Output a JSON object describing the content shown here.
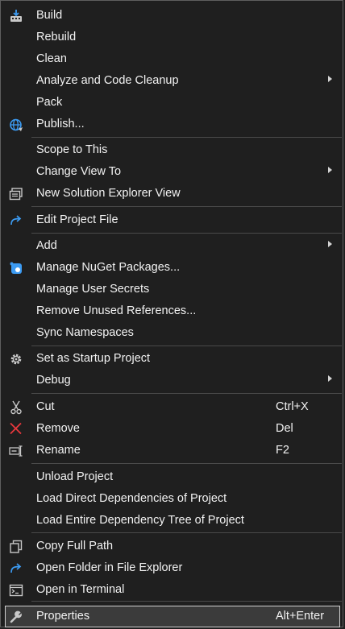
{
  "menu": {
    "build": {
      "label": "Build",
      "icon": "build-icon"
    },
    "rebuild": {
      "label": "Rebuild"
    },
    "clean": {
      "label": "Clean"
    },
    "analyze": {
      "label": "Analyze and Code Cleanup"
    },
    "pack": {
      "label": "Pack"
    },
    "publish": {
      "label": "Publish...",
      "icon": "globe-icon"
    },
    "scope_to_this": {
      "label": "Scope to This"
    },
    "change_view_to": {
      "label": "Change View To"
    },
    "new_solution_explorer_view": {
      "label": "New Solution Explorer View",
      "icon": "new-window-icon"
    },
    "edit_project_file": {
      "label": "Edit Project File",
      "icon": "redo-arrow-icon"
    },
    "add": {
      "label": "Add"
    },
    "manage_nuget": {
      "label": "Manage NuGet Packages...",
      "icon": "nuget-icon"
    },
    "manage_user_secrets": {
      "label": "Manage User Secrets"
    },
    "remove_unused_references": {
      "label": "Remove Unused References..."
    },
    "sync_namespaces": {
      "label": "Sync Namespaces"
    },
    "set_startup": {
      "label": "Set as Startup Project",
      "icon": "gear-icon"
    },
    "debug": {
      "label": "Debug"
    },
    "cut": {
      "label": "Cut",
      "shortcut": "Ctrl+X",
      "icon": "scissors-icon"
    },
    "remove": {
      "label": "Remove",
      "shortcut": "Del",
      "icon": "red-x-icon"
    },
    "rename": {
      "label": "Rename",
      "shortcut": "F2",
      "icon": "rename-icon"
    },
    "unload_project": {
      "label": "Unload Project"
    },
    "load_direct_deps": {
      "label": "Load Direct Dependencies of Project"
    },
    "load_entire_tree": {
      "label": "Load Entire Dependency Tree of Project"
    },
    "copy_full_path": {
      "label": "Copy Full Path",
      "icon": "copy-icon"
    },
    "open_folder": {
      "label": "Open Folder in File Explorer",
      "icon": "redo-arrow-icon"
    },
    "open_terminal": {
      "label": "Open in Terminal",
      "icon": "terminal-icon"
    },
    "properties": {
      "label": "Properties",
      "shortcut": "Alt+Enter",
      "icon": "wrench-icon"
    }
  },
  "colors": {
    "background": "#1f1f1f",
    "border": "#5f5f5f",
    "text": "#f2f2f2",
    "separator": "#4a4a4a",
    "selected_background": "#3b3b3b",
    "accent_blue": "#3c9bf2",
    "remove_red": "#e8383d"
  }
}
